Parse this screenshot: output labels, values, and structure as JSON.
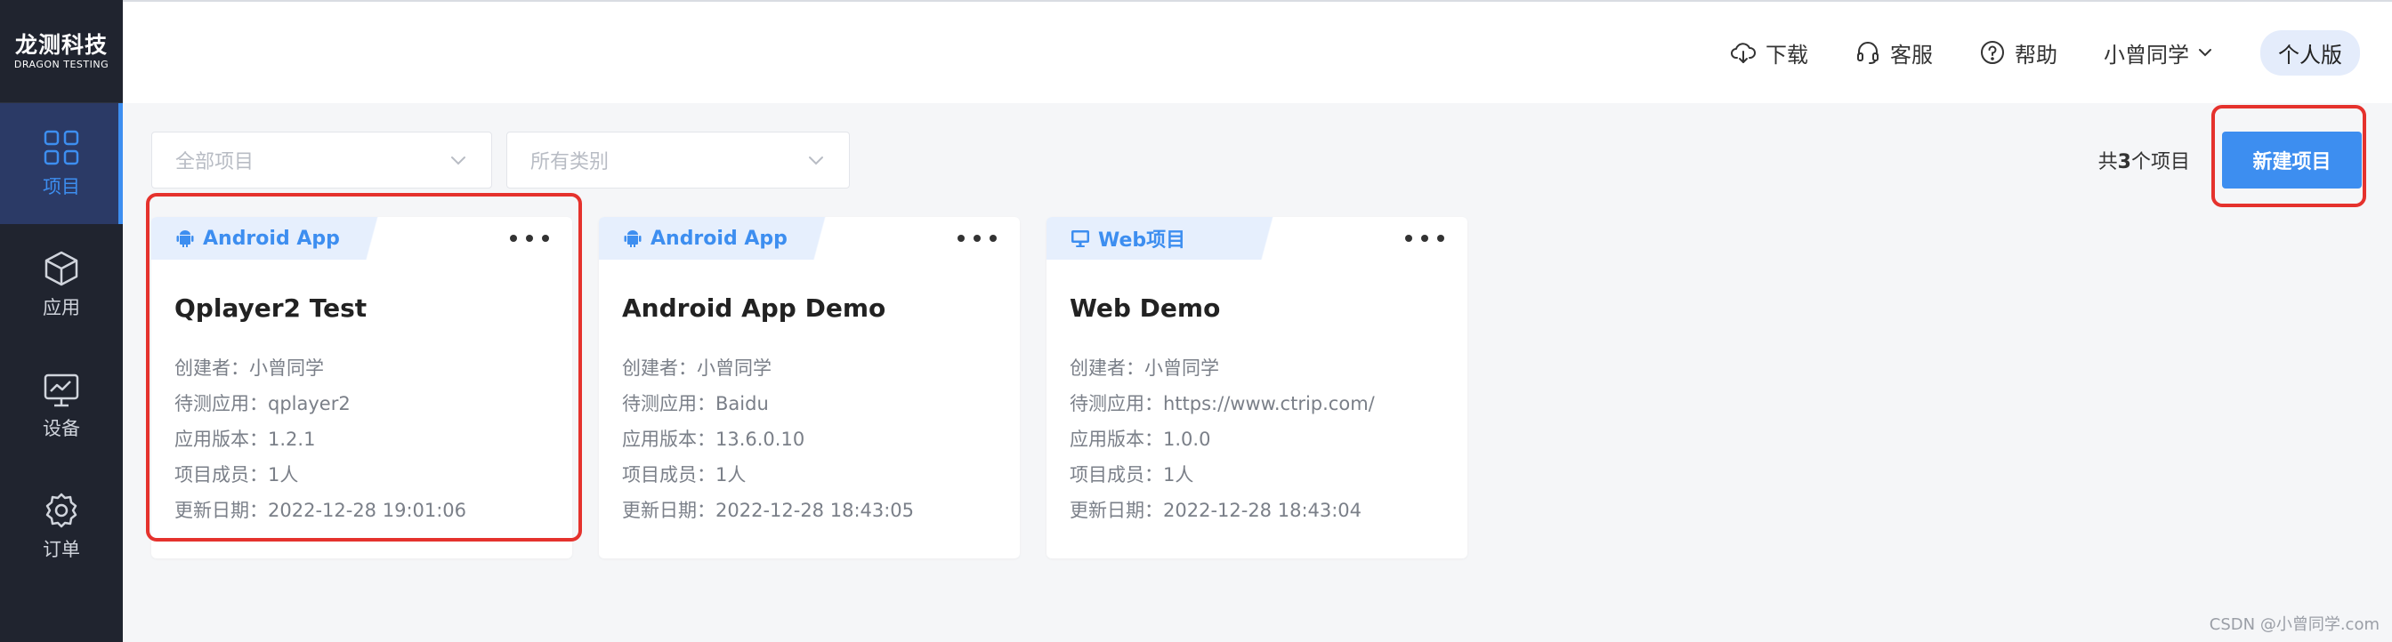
{
  "app": {
    "logo_cn": "龙测科技",
    "logo_en": "DRAGON TESTING"
  },
  "sidebar": {
    "items": [
      {
        "label": "项目",
        "icon": "grid-icon"
      },
      {
        "label": "应用",
        "icon": "cube-icon"
      },
      {
        "label": "设备",
        "icon": "monitor-icon"
      },
      {
        "label": "订单",
        "icon": "gear-icon"
      }
    ]
  },
  "header": {
    "download": "下载",
    "support": "客服",
    "help": "帮助",
    "user": "小曾同学",
    "edition": "个人版"
  },
  "filters": {
    "project": "全部项目",
    "category": "所有类别",
    "count_prefix": "共",
    "count": "3",
    "count_suffix": "个项目",
    "new_project": "新建项目"
  },
  "cards": [
    {
      "tag": "Android App",
      "title": "Qplayer2 Test",
      "creator": "创建者：小曾同学",
      "app": "待测应用：qplayer2",
      "version": "应用版本：1.2.1",
      "members": "项目成员：1人",
      "updated": "更新日期：2022-12-28 19:01:06"
    },
    {
      "tag": "Android App",
      "title": "Android App Demo",
      "creator": "创建者：小曾同学",
      "app": "待测应用：Baidu",
      "version": "应用版本：13.6.0.10",
      "members": "项目成员：1人",
      "updated": "更新日期：2022-12-28 18:43:05"
    },
    {
      "tag": "Web项目",
      "title": "Web Demo",
      "creator": "创建者：小曾同学",
      "app": "待测应用：https://www.ctrip.com/",
      "version": "应用版本：1.0.0",
      "members": "项目成员：1人",
      "updated": "更新日期：2022-12-28 18:43:04"
    }
  ],
  "watermark": "CSDN @小曾同学.com",
  "colors": {
    "accent": "#3d8ef0",
    "sidebar": "#20242f",
    "highlight": "#e5322d"
  }
}
